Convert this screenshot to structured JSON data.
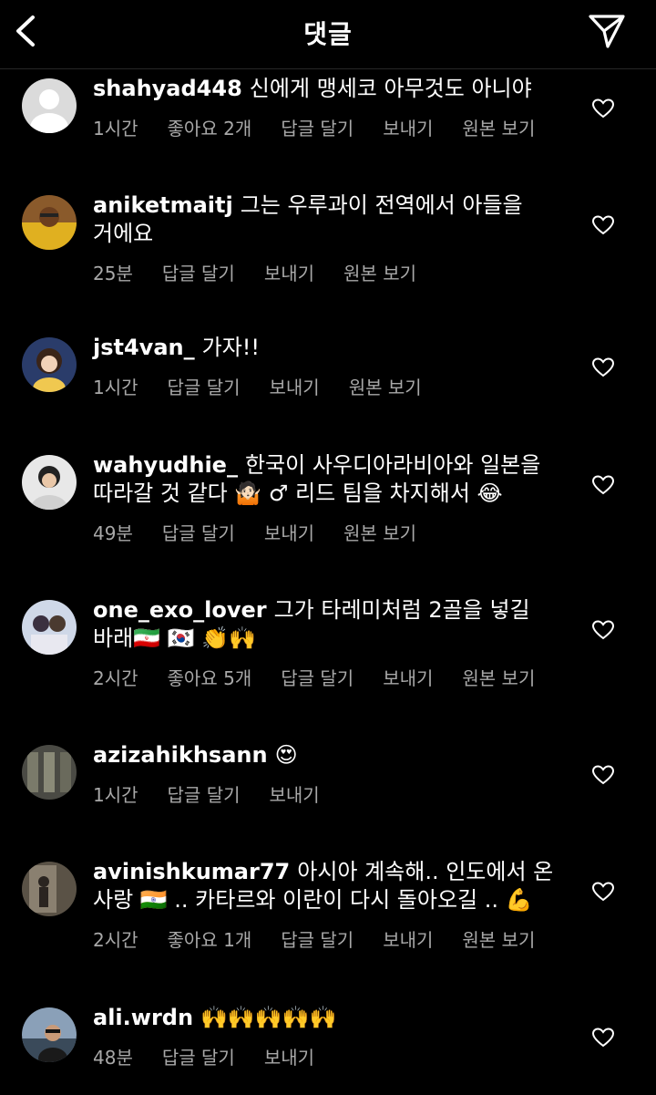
{
  "header": {
    "title": "댓글",
    "back_icon": "chevron-left-icon",
    "action_icon": "send-icon"
  },
  "comments": [
    {
      "username": "shahyad448",
      "text": "신에게 맹세코 아무것도 아니야",
      "time": "1시간",
      "likes": "좋아요 2개",
      "reply": "답글 달기",
      "send": "보내기",
      "original": "원본 보기"
    },
    {
      "username": "aniketmaitj",
      "text": "그는 우루과이 전역에서 아들을 거에요",
      "time": "25분",
      "reply": "답글 달기",
      "send": "보내기",
      "original": "원본 보기"
    },
    {
      "username": "jst4van_",
      "text": "가자!!",
      "time": "1시간",
      "reply": "답글 달기",
      "send": "보내기",
      "original": "원본 보기"
    },
    {
      "username": "wahyudhie_",
      "text": "한국이 사우디아라비아와 일본을 따라갈 것 같다 🤷🏻 ♂ 리드 팀을 차지해서 😂",
      "time": "49분",
      "reply": "답글 달기",
      "send": "보내기",
      "original": "원본 보기"
    },
    {
      "username": "one_exo_lover",
      "text": "그가 타레미처럼 2골을 넣길 바래🇮🇷 🇰🇷 👏🙌",
      "time": "2시간",
      "likes": "좋아요 5개",
      "reply": "답글 달기",
      "send": "보내기",
      "original": "원본 보기"
    },
    {
      "username": "azizahikhsann",
      "text": "😍",
      "time": "1시간",
      "reply": "답글 달기",
      "send": "보내기"
    },
    {
      "username": "avinishkumar77",
      "text": "아시아 계속해.. 인도에서 온 사랑 🇮🇳 .. 카타르와 이란이 다시 돌아오길 .. 💪",
      "time": "2시간",
      "likes": "좋아요 1개",
      "reply": "답글 달기",
      "send": "보내기",
      "original": "원본 보기"
    },
    {
      "username": "ali.wrdn",
      "text": "🙌🙌🙌🙌🙌",
      "time": "48분",
      "reply": "답글 달기",
      "send": "보내기"
    }
  ]
}
